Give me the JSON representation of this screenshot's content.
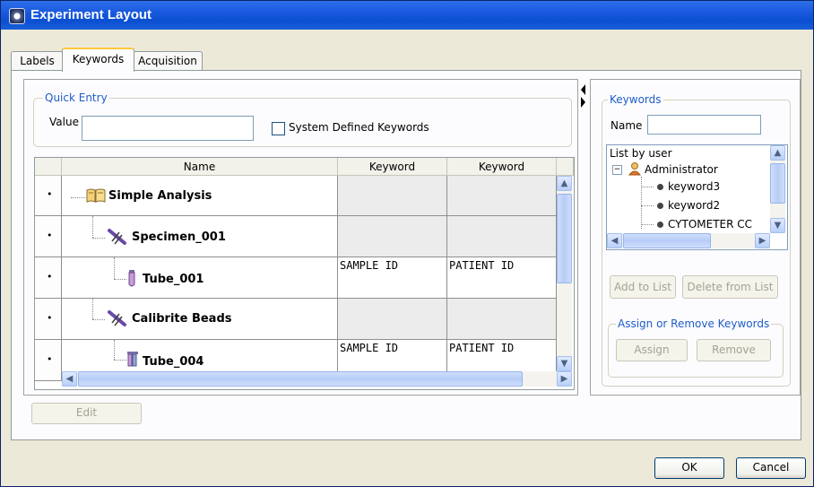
{
  "window": {
    "title": "Experiment Layout",
    "icon": "app-icon"
  },
  "tabs": [
    {
      "label": "Labels",
      "active": false
    },
    {
      "label": "Keywords",
      "active": true
    },
    {
      "label": "Acquisition",
      "active": false
    }
  ],
  "quick_entry": {
    "legend": "Quick Entry",
    "value_label": "Value",
    "value": "",
    "system_defined_label": "System Defined Keywords",
    "system_defined_checked": false
  },
  "grid": {
    "columns": [
      "Name",
      "Keyword",
      "Keyword"
    ],
    "rows": [
      {
        "name": "Simple Analysis",
        "icon": "book-icon",
        "keyword1": "",
        "keyword2": ""
      },
      {
        "name": "Specimen_001",
        "icon": "specimen-icon",
        "keyword1": "",
        "keyword2": ""
      },
      {
        "name": "Tube_001",
        "icon": "tube-icon",
        "keyword1": "SAMPLE ID",
        "keyword2": "PATIENT ID"
      },
      {
        "name": "Calibrite Beads",
        "icon": "specimen-icon",
        "keyword1": "",
        "keyword2": ""
      },
      {
        "name": "Tube_004",
        "icon": "tube-icon",
        "keyword1": "SAMPLE ID",
        "keyword2": "PATIENT ID"
      }
    ],
    "row_marker": "•"
  },
  "edit_button": "Edit",
  "keywords_panel": {
    "legend": "Keywords",
    "name_label": "Name",
    "name_value": "",
    "tree": {
      "root_label": "List by user",
      "user": "Administrator",
      "items": [
        "keyword3",
        "keyword2",
        "CYTOMETER CC"
      ]
    },
    "add_button": "Add to List",
    "delete_button": "Delete from List",
    "assign_legend": "Assign or Remove Keywords",
    "assign_button": "Assign",
    "remove_button": "Remove"
  },
  "footer": {
    "ok": "OK",
    "cancel": "Cancel"
  },
  "colors": {
    "titlebar": "#0a4fd1",
    "accent": "#1f5cc8",
    "tab_highlight": "#ffc83c"
  }
}
